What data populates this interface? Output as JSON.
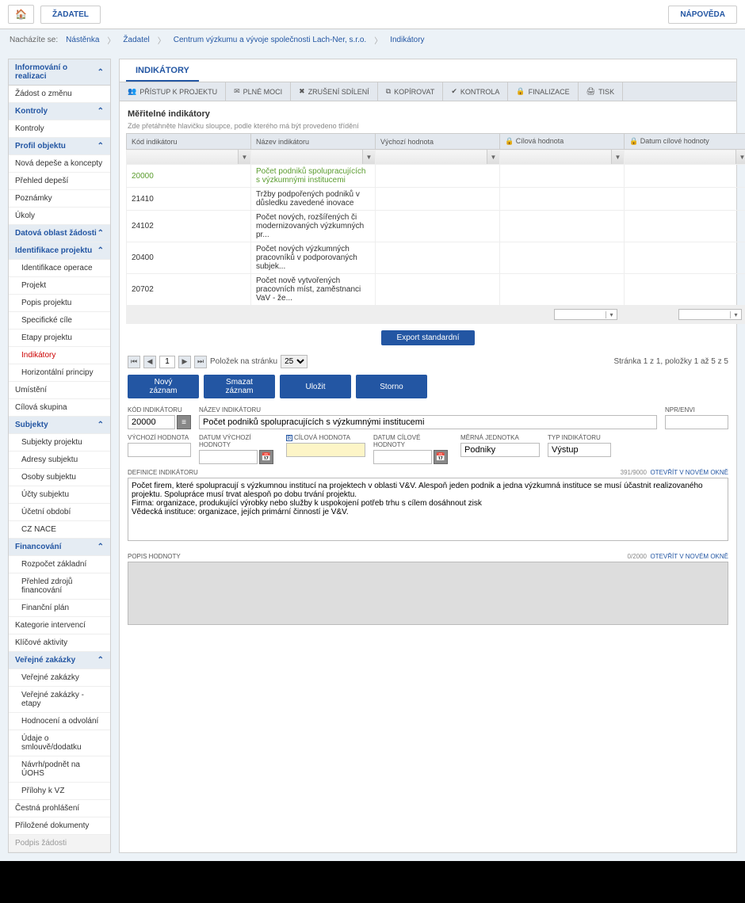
{
  "topbar": {
    "applicant": "ŽADATEL",
    "help": "NÁPOVĚDA"
  },
  "breadcrumb": {
    "label": "Nacházíte se:",
    "items": [
      "Nástěnka",
      "Žadatel",
      "Centrum výzkumu a vývoje společnosti Lach-Ner, s.r.o.",
      "Indikátory"
    ]
  },
  "sidebar": {
    "sec1": "Informování o realizaci",
    "s1_1": "Žádost o změnu",
    "sec2": "Kontroly",
    "s2_1": "Kontroly",
    "sec3": "Profil objektu",
    "s3_1": "Nová depeše a koncepty",
    "s3_2": "Přehled depeší",
    "s3_3": "Poznámky",
    "s3_4": "Úkoly",
    "sec4": "Datová oblast žádosti",
    "s4_1": "Identifikace projektu",
    "s4_1_1": "Identifikace operace",
    "s4_1_2": "Projekt",
    "s4_1_3": "Popis projektu",
    "s4_1_4": "Specifické cíle",
    "s4_1_5": "Etapy projektu",
    "s4_1_6": "Indikátory",
    "s4_1_7": "Horizontální principy",
    "s4_2": "Umístění",
    "s4_3": "Cílová skupina",
    "s4_4": "Subjekty",
    "s4_4_1": "Subjekty projektu",
    "s4_4_2": "Adresy subjektu",
    "s4_4_3": "Osoby subjektu",
    "s4_4_4": "Účty subjektu",
    "s4_4_5": "Účetní období",
    "s4_4_6": "CZ NACE",
    "s4_5": "Financování",
    "s4_5_1": "Rozpočet základní",
    "s4_5_2": "Přehled zdrojů financování",
    "s4_5_3": "Finanční plán",
    "s4_6": "Kategorie intervencí",
    "s4_7": "Klíčové aktivity",
    "s4_8": "Veřejné zakázky",
    "s4_8_1": "Veřejné zakázky",
    "s4_8_2": "Veřejné zakázky - etapy",
    "s4_8_3": "Hodnocení a odvolání",
    "s4_8_4": "Údaje o smlouvě/dodatku",
    "s4_8_5": "Návrh/podnět na ÚOHS",
    "s4_8_6": "Přílohy k VZ",
    "s4_9": "Čestná prohlášení",
    "s4_10": "Přiložené dokumenty",
    "s4_11": "Podpis žádosti"
  },
  "main": {
    "tab": "INDIKÁTORY",
    "tools": {
      "access": "PŘÍSTUP K PROJEKTU",
      "power": "PLNÉ MOCI",
      "cancel": "ZRUŠENÍ SDÍLENÍ",
      "copy": "KOPÍROVAT",
      "check": "KONTROLA",
      "finalize": "FINALIZACE",
      "print": "TISK"
    },
    "section": "Měřitelné indikátory",
    "hint": "Zde přetáhněte hlavičku sloupce, podle kterého má být provedeno třídění",
    "cols": {
      "code": "Kód indikátoru",
      "name": "Název indikátoru",
      "start": "Výchozí hodnota",
      "target": "Cílová hodnota",
      "date": "Datum cílové hodnoty"
    },
    "rows": [
      {
        "code": "20000",
        "name": "Počet podniků spolupracujících s výzkumnými institucemi",
        "hl": true
      },
      {
        "code": "21410",
        "name": "Tržby podpořených podniků v důsledku zavedené inovace"
      },
      {
        "code": "24102",
        "name": "Počet nových, rozšířených či modernizovaných výzkumných pr..."
      },
      {
        "code": "20400",
        "name": "Počet nových výzkumných pracovníků v podporovaných subjek..."
      },
      {
        "code": "20702",
        "name": "Počet nově vytvořených pracovních míst, zaměstnanci VaV - že..."
      }
    ],
    "export": "Export standardní",
    "pager": {
      "page": "1",
      "perpage_label": "Položek na stránku",
      "perpage": "25",
      "info": "Stránka 1 z 1, položky 1 až 5 z 5"
    },
    "actions": {
      "new": "Nový záznam",
      "delete": "Smazat záznam",
      "save": "Uložit",
      "storno": "Storno"
    },
    "form": {
      "code_label": "KÓD INDIKÁTORU",
      "code": "20000",
      "name_label": "NÁZEV INDIKÁTORU",
      "name": "Počet podniků spolupracujících s výzkumnými institucemi",
      "npr_label": "NPR/ENVI",
      "start_label": "VÝCHOZÍ HODNOTA",
      "start_date_label": "DATUM VÝCHOZÍ HODNOTY",
      "target_label": "CÍLOVÁ HODNOTA",
      "target_date_label": "DATUM CÍLOVÉ HODNOTY",
      "unit_label": "MĚRNÁ JEDNOTKA",
      "unit": "Podniky",
      "type_label": "TYP INDIKÁTORU",
      "type": "Výstup",
      "def_label": "DEFINICE INDIKÁTORU",
      "def_count": "391/9000",
      "def_link": "Otevřít v novém okně",
      "def": "Počet firem, které spolupracují s výzkumnou institucí na projektech v oblasti V&V. Alespoň jeden podnik a jedna výzkumná instituce se musí účastnit realizovaného projektu. Spolupráce musí trvat alespoň po dobu trvání projektu.\nFirma: organizace, produkující výrobky nebo služby k uspokojení potřeb trhu s cílem dosáhnout zisk\nVědecká instituce: organizace, jejích primární činností je V&V.",
      "desc_label": "POPIS HODNOTY",
      "desc_count": "0/2000",
      "desc_link": "Otevřít v novém okně"
    }
  }
}
